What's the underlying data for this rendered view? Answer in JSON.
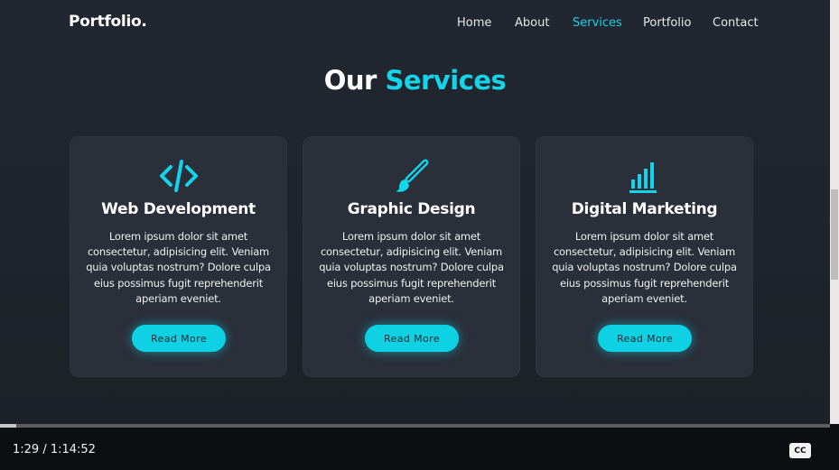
{
  "site": {
    "logo": "Portfolio.",
    "nav": [
      {
        "label": "Home",
        "active": false
      },
      {
        "label": "About",
        "active": false
      },
      {
        "label": "Services",
        "active": true
      },
      {
        "label": "Portfolio",
        "active": false
      },
      {
        "label": "Contact",
        "active": false
      }
    ]
  },
  "section": {
    "heading_plain": "Our",
    "heading_accent": "Services"
  },
  "cards": [
    {
      "icon": "code-icon",
      "title": "Web Development",
      "text": "Lorem ipsum dolor sit amet consectetur, adipisicing elit. Veniam quia voluptas nostrum? Dolore culpa eius possimus fugit reprehenderit aperiam eveniet.",
      "button": "Read More"
    },
    {
      "icon": "paintbrush-icon",
      "title": "Graphic Design",
      "text": "Lorem ipsum dolor sit amet consectetur, adipisicing elit. Veniam quia voluptas nostrum? Dolore culpa eius possimus fugit reprehenderit aperiam eveniet.",
      "button": "Read More"
    },
    {
      "icon": "bar-chart-icon",
      "title": "Digital Marketing",
      "text": "Lorem ipsum dolor sit amet consectetur, adipisicing elit. Veniam quia voluptas nostrum? Dolore culpa eius possimus fugit reprehenderit aperiam eveniet.",
      "button": "Read More"
    }
  ],
  "player": {
    "time": "1:29 / 1:14:52",
    "cc_label": "CC",
    "progress_fraction": 0.0198
  },
  "colors": {
    "accent": "#13d4e8",
    "background": "#1f232b",
    "card": "#2a2f3a",
    "button": "#0ed2e4"
  }
}
